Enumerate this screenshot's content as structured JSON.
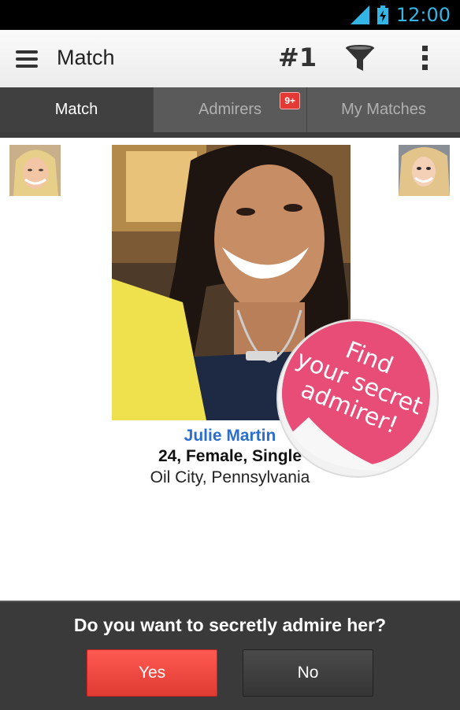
{
  "status_bar": {
    "time": "12:00"
  },
  "action_bar": {
    "title": "Match",
    "rank_label": "#1"
  },
  "tabs": [
    {
      "label": "Match"
    },
    {
      "label": "Admirers",
      "badge": "9+"
    },
    {
      "label": "My Matches"
    }
  ],
  "profile": {
    "name": "Julie Martin",
    "info": "24, Female, Single",
    "location": "Oil City, Pennsylvania"
  },
  "sticker": {
    "lines": [
      "Find",
      "your secret",
      "admirer!"
    ]
  },
  "prompt": {
    "question": "Do you want to secretly admire her?",
    "yes_label": "Yes",
    "no_label": "No"
  },
  "colors": {
    "accent": "#33b5e5",
    "name_blue": "#2a6fcf",
    "sticker_pink": "#e84d77",
    "yes_red": "#f04a42"
  }
}
